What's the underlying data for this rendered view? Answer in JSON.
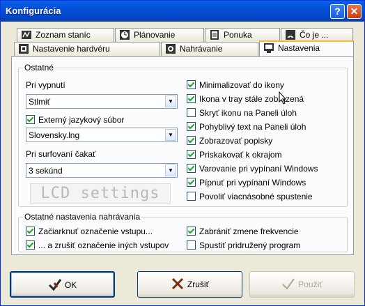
{
  "window": {
    "title": "Konfigurácia"
  },
  "tabs_row1": [
    "Zoznam staníc",
    "Plánovanie",
    "Ponuka",
    "Čo je ..."
  ],
  "tabs_row2": [
    "Nastavenie hardvéru",
    "Nahrávanie",
    "Nastavenia"
  ],
  "active_tab": "Nastavenia",
  "other_group": {
    "title": "Ostatné",
    "shutdown_label": "Pri vypnutí",
    "shutdown_value": "Stlmiť",
    "external_lang_label": "Externý jazykový súbor",
    "external_lang_checked": true,
    "lang_file_value": "Slovensky.lng",
    "surf_wait_label": "Pri surfovaní čakať",
    "surf_wait_value": "3 sekúnd",
    "lcd_button": "LCD settings",
    "options": [
      {
        "label": "Minimalizovať do ikony",
        "checked": true
      },
      {
        "label": "Ikona v tray stále zobrazená",
        "checked": true
      },
      {
        "label": "Skryť ikonu na Paneli úloh",
        "checked": false
      },
      {
        "label": "Pohyblivý text na Paneli úloh",
        "checked": true
      },
      {
        "label": "Zobrazovať popisky",
        "checked": true
      },
      {
        "label": "Priskakovať k okrajom",
        "checked": true
      },
      {
        "label": "Varovanie pri vypínaní Windows",
        "checked": true
      },
      {
        "label": "Pípnuť pri vypínaní Windows",
        "checked": true
      },
      {
        "label": "Povoliť viacnásobné spustenie",
        "checked": false
      }
    ]
  },
  "recording_group": {
    "title": "Ostatné nastavenia nahrávania",
    "options": [
      {
        "label": "Začiarknuť označenie vstupu...",
        "checked": true
      },
      {
        "label": "... a zrušiť označenie iných vstupov",
        "checked": true
      },
      {
        "label": "Zabrániť zmene frekvencie",
        "checked": true
      },
      {
        "label": "Spustiť pridružený program",
        "checked": false
      }
    ]
  },
  "buttons": {
    "ok": "OK",
    "cancel": "Zrušiť",
    "apply": "Použiť"
  },
  "colors": {
    "titlebar": "#0450d7",
    "face": "#ece9d8",
    "tab_highlight": "#f7b53a"
  }
}
